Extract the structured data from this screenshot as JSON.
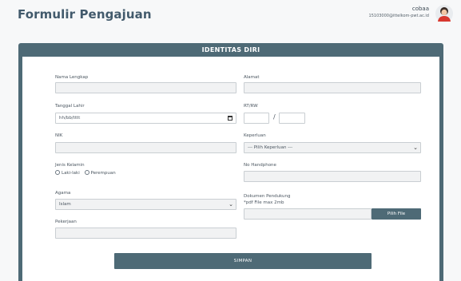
{
  "header": {
    "title": "Formulir Pengajuan",
    "user_name": "cobaa",
    "user_email": "15103000@ittelkom-pwt.ac.id"
  },
  "form": {
    "section_title": "IDENTITAS DIRI",
    "nama_label": "Nama Lengkap",
    "tanggal_label": "Tanggal Lahir",
    "tanggal_value": "hh/bb/tttt",
    "nik_label": "NIK",
    "jk_label": "Jenis Kelamin",
    "jk_options": [
      "Laki-laki",
      "Perempuan"
    ],
    "agama_label": "Agama",
    "agama_value": "Islam",
    "pekerjaan_label": "Pekerjaan",
    "alamat_label": "Alamat",
    "rtrw_label": "RT/RW",
    "rtrw_separator": "/",
    "keperluan_label": "Keperluan",
    "keperluan_value": "--- Pilih Keperluan ---",
    "hp_label": "No Handphone",
    "dokumen_label": "Dokumen Pendukung",
    "dokumen_hint": "*pdf File max 2mb",
    "file_button": "Pilih File",
    "submit_label": "SIMPAN"
  }
}
